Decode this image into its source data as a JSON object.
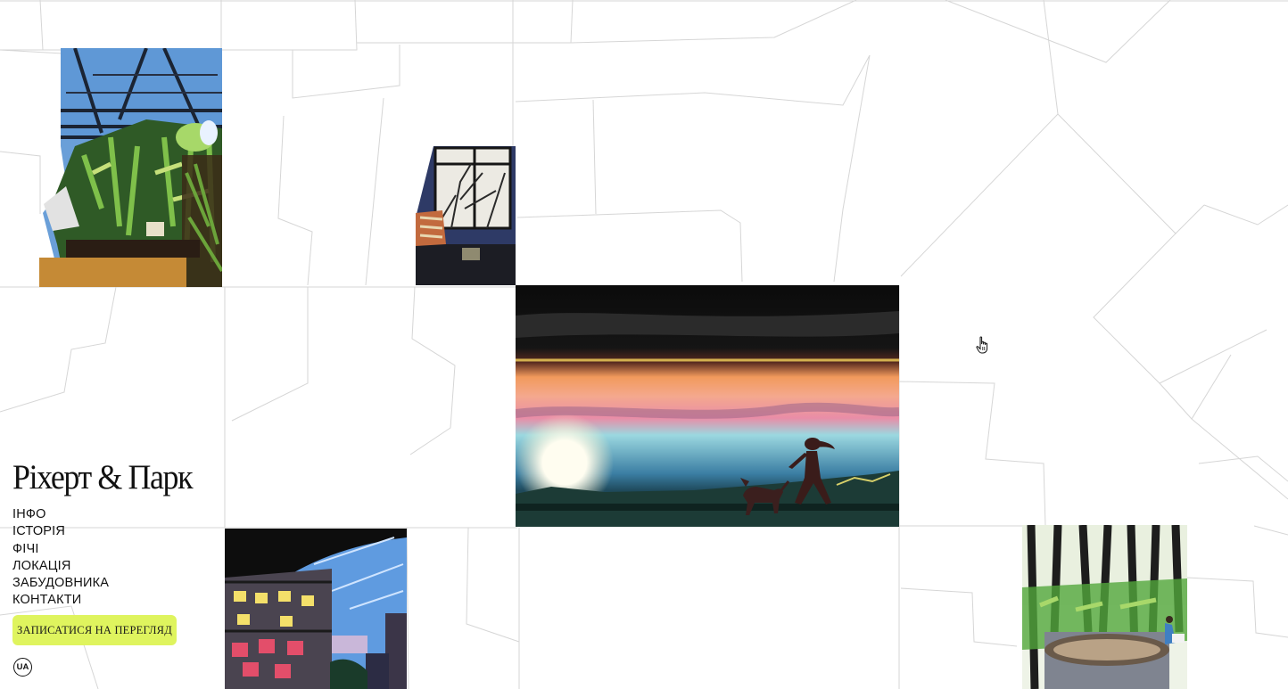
{
  "brand": {
    "name": "Ріхерт & Парк"
  },
  "nav": {
    "items": [
      {
        "label": "ІНФО"
      },
      {
        "label": "ІСТОРІЯ"
      },
      {
        "label": "ФІЧІ"
      },
      {
        "label": "ЛОКАЦІЯ"
      },
      {
        "label": "ЗАБУДОВНИКА"
      },
      {
        "label": "КОНТАКТИ"
      }
    ]
  },
  "cta": {
    "label": "ЗАПИСАТИСЯ НА ПЕРЕГЛЯД"
  },
  "language": {
    "label": "UA"
  },
  "colors": {
    "accent": "#dff45e",
    "text": "#111111",
    "map_lines": "#d4d4d4"
  }
}
